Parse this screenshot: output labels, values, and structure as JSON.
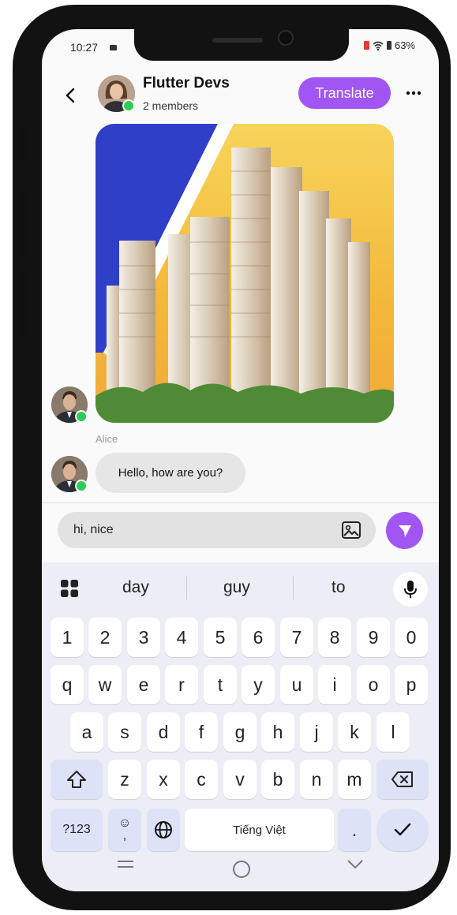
{
  "status_bar": {
    "time": "10:27",
    "battery": "63%"
  },
  "header": {
    "title": "Flutter Devs",
    "subtitle": "2 members",
    "translate_label": "Translate"
  },
  "messages": [
    {
      "sender": "",
      "type": "image",
      "image_alt": ""
    },
    {
      "sender": "Alice",
      "type": "text",
      "text": "Hello, how are you?"
    }
  ],
  "composer": {
    "value": "hi, nice"
  },
  "keyboard": {
    "suggestions": [
      "day",
      "guy",
      "to"
    ],
    "rows": [
      [
        "1",
        "2",
        "3",
        "4",
        "5",
        "6",
        "7",
        "8",
        "9",
        "0"
      ],
      [
        "q",
        "w",
        "e",
        "r",
        "t",
        "y",
        "u",
        "i",
        "o",
        "p"
      ],
      [
        "a",
        "s",
        "d",
        "f",
        "g",
        "h",
        "j",
        "k",
        "l"
      ],
      [
        "z",
        "x",
        "c",
        "v",
        "b",
        "n",
        "m"
      ]
    ],
    "symbols_label": "?123",
    "emoji_key": "☺",
    "comma_label": ",",
    "space_label": "Tiếng Việt",
    "period_label": "."
  },
  "colors": {
    "accent": "#a155f2",
    "online": "#2ecc56",
    "keyboard_bg": "#ecedf5"
  }
}
